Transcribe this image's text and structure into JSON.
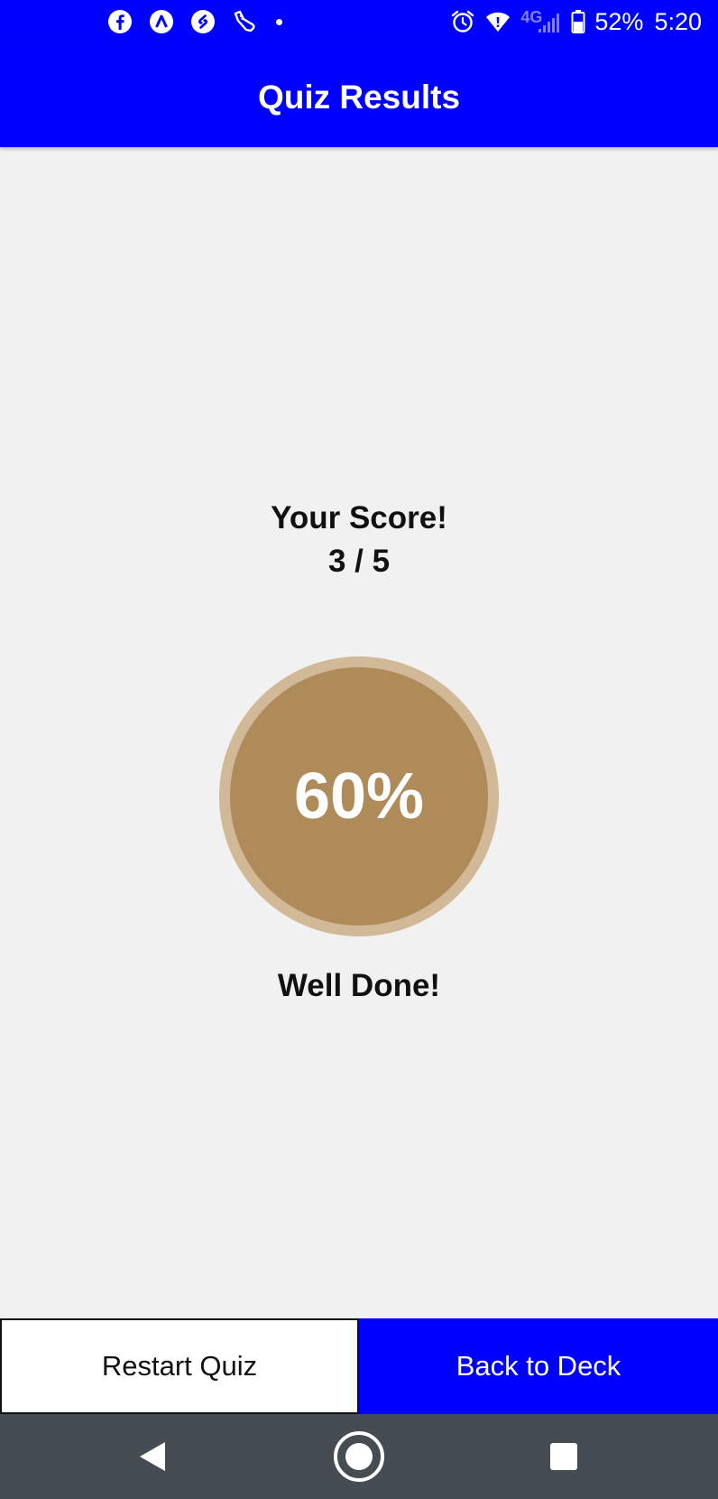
{
  "status_bar": {
    "notification_icons": [
      "facebook-icon",
      "app-a-icon",
      "shazam-icon",
      "sneaker-icon",
      "notification-dot-icon"
    ],
    "system_icons": [
      "alarm-icon",
      "wifi-icon",
      "network-type-icon",
      "signal-icon",
      "battery-icon"
    ],
    "network_type": "4G",
    "battery": "52%",
    "time": "5:20"
  },
  "app_bar": {
    "title": "Quiz Results"
  },
  "results": {
    "score_label": "Your Score!",
    "score_value": "3 / 5",
    "percent": 0.6,
    "percent_text": "60%",
    "message": "Well Done!"
  },
  "actions": {
    "restart_label": "Restart Quiz",
    "back_label": "Back to Deck"
  },
  "nav": {
    "buttons": [
      "back-icon",
      "home-icon",
      "recents-icon"
    ]
  },
  "colors": {
    "primary": "#0000ff",
    "background": "#f2f1f1",
    "circle_fill": "#ae8b59",
    "circle_ring": "#d1b896",
    "nav_bar": "#454c52"
  }
}
